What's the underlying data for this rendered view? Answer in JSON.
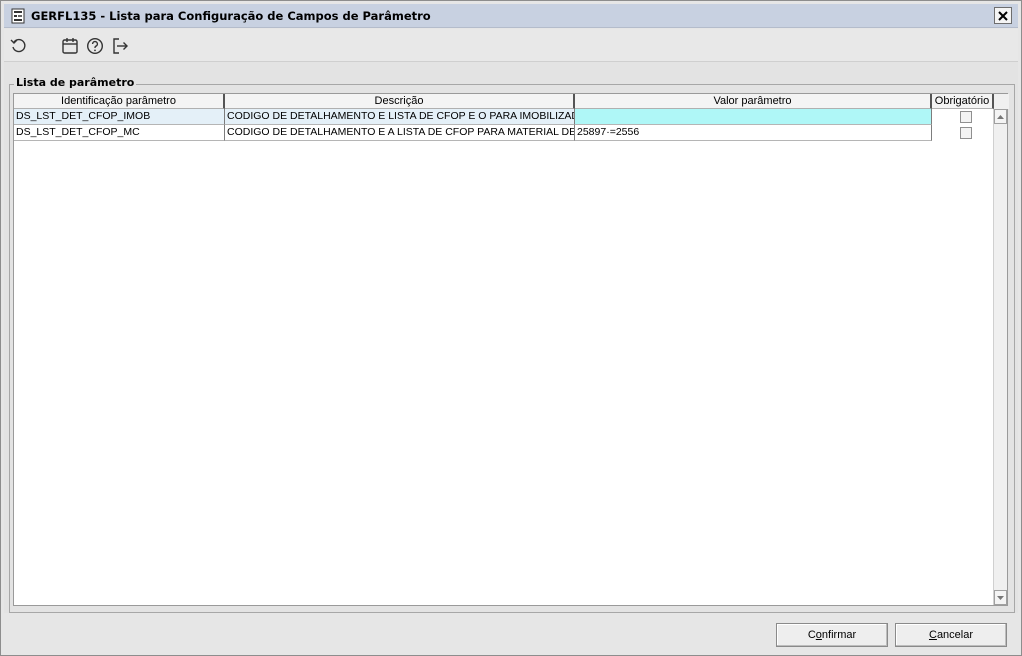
{
  "window": {
    "title": "GERFL135 - Lista para Configuração de Campos de Parâmetro",
    "icon": "document-form-icon"
  },
  "toolbar": {
    "icons": [
      "refresh-icon",
      "calendar-icon",
      "help-icon",
      "exit-icon"
    ]
  },
  "group": {
    "legend": "Lista de parâmetro"
  },
  "table": {
    "columns": [
      "Identificação parâmetro",
      "Descrição",
      "Valor parâmetro",
      "Obrigatório"
    ],
    "rows": [
      {
        "id": "DS_LST_DET_CFOP_IMOB",
        "descricao": "CODIGO DE DETALHAMENTO E LISTA DE CFOP E O PARA IMOBILIZADO",
        "valor": "",
        "obrigatorio": false,
        "selected": true
      },
      {
        "id": "DS_LST_DET_CFOP_MC",
        "descricao": "CODIGO DE DETALHAMENTO E A LISTA DE CFOP PARA MATERIAL DE CONSUMO",
        "valor": "25897·=2556",
        "obrigatorio": false,
        "selected": false
      }
    ]
  },
  "buttons": {
    "confirmar_prefix": "C",
    "confirmar_mnemonic": "o",
    "confirmar_rest": "nfirmar",
    "cancelar_mnemonic": "C",
    "cancelar_rest": "ancelar"
  },
  "colors": {
    "selected_row": "#e4f0f8",
    "selected_value_cell": "#aff7f7",
    "titlebar": "#c8d1e1"
  }
}
